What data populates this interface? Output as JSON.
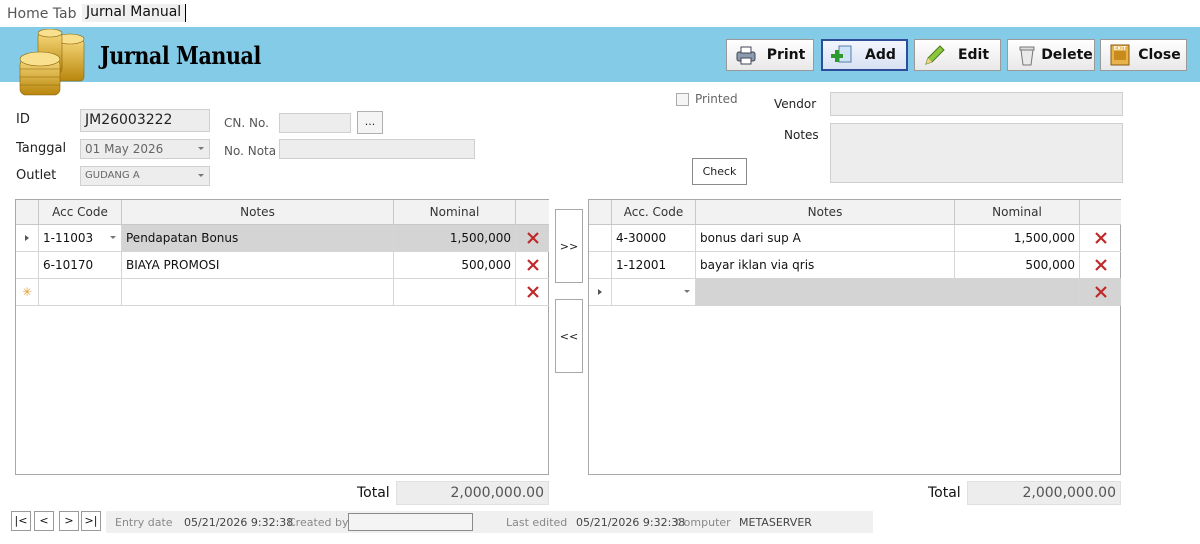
{
  "tabs": [
    {
      "label": "Home Tab"
    },
    {
      "label": "Jurnal Manual"
    }
  ],
  "header": {
    "title": "Jurnal Manual",
    "buttons": {
      "print": "Print",
      "add": "Add",
      "edit": "Edit",
      "delete": "Delete",
      "close": "Close"
    },
    "close_icon_text": "EXIT"
  },
  "form": {
    "id_label": "ID",
    "id_value": "JM26003222",
    "cn_label": "CN. No.",
    "cn_value": "",
    "cn_browse": "...",
    "tanggal_label": "Tanggal",
    "tanggal_value": "01 May 2026",
    "nota_label": "No. Nota",
    "nota_value": "",
    "outlet_label": "Outlet",
    "outlet_value": "GUDANG A",
    "printed_label": "Printed",
    "vendor_label": "Vendor",
    "vendor_value": "",
    "notes_label": "Notes",
    "notes_value": "",
    "check_button": "Check"
  },
  "left_grid": {
    "headers": [
      "Acc Code",
      "Notes",
      "Nominal"
    ],
    "rows": [
      {
        "code": "1-11003",
        "notes": "Pendapatan Bonus",
        "nominal": "1,500,000"
      },
      {
        "code": "6-10170",
        "notes": "BIAYA PROMOSI",
        "nominal": "500,000"
      }
    ],
    "new_row_marker": "✳"
  },
  "right_grid": {
    "headers": [
      "Acc. Code",
      "Notes",
      "Nominal"
    ],
    "rows": [
      {
        "code": "4-30000",
        "notes": "bonus dari sup A",
        "nominal": "1,500,000"
      },
      {
        "code": "1-12001",
        "notes": "bayar iklan via qris",
        "nominal": "500,000"
      }
    ]
  },
  "transfer": {
    "right": ">>",
    "left": "<<"
  },
  "totals": {
    "label": "Total",
    "left_value": "2,000,000.00",
    "right_value": "2,000,000.00"
  },
  "nav": {
    "first": "|<",
    "prev": "<",
    "next": ">",
    "last": ">|"
  },
  "footer": {
    "entry_date_label": "Entry date",
    "entry_date_value": "05/21/2026 9:32:38",
    "created_by_label": "Created by",
    "created_by_value": "",
    "last_edited_label": "Last edited",
    "last_edited_value": "05/21/2026 9:32:38",
    "computer_label": "Computer",
    "computer_value": "METASERVER"
  },
  "colors": {
    "header_band": "#83cbe6",
    "delete_x": "#c0282a",
    "selected_row": "#d4d4d4"
  }
}
